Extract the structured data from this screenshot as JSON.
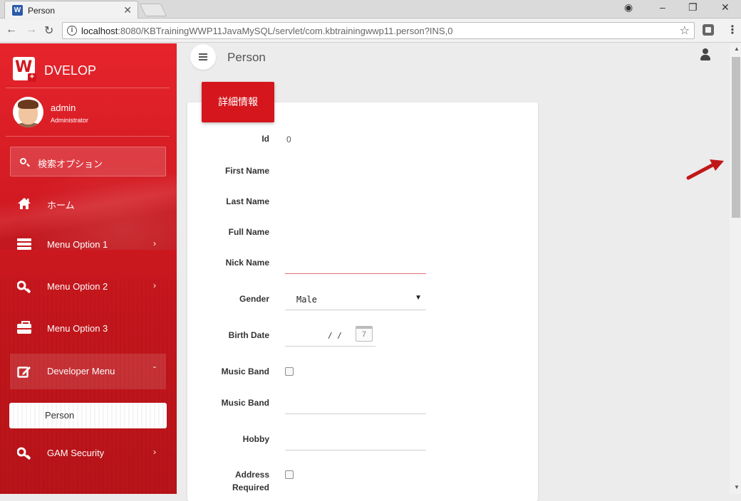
{
  "browser": {
    "tab_title": "Person",
    "tab_favicon_letter": "W",
    "url_host": "localhost",
    "url_rest": ":8080/KBTrainingWWP11JavaMySQL/servlet/com.kbtrainingwwp11.person?INS,0"
  },
  "brand": {
    "name": "DVELOP",
    "logo_letter": "W",
    "logo_badge": "+"
  },
  "user": {
    "name": "admin",
    "role": "Administrator"
  },
  "sidebar": {
    "search_label": "検索オプション",
    "items": [
      {
        "label": "ホーム",
        "icon": "home-icon",
        "has_submenu": false
      },
      {
        "label": "Menu Option 1",
        "icon": "list-icon",
        "has_submenu": true
      },
      {
        "label": "Menu Option 2",
        "icon": "key-icon",
        "has_submenu": true
      },
      {
        "label": "Menu Option 3",
        "icon": "briefcase-icon",
        "has_submenu": false
      },
      {
        "label": "Developer Menu",
        "icon": "edit-icon",
        "has_submenu": true,
        "expanded": true
      },
      {
        "label": "GAM Security",
        "icon": "key-icon",
        "has_submenu": true
      }
    ],
    "subitem": "Person",
    "chevron_right": "›",
    "chevron_down": "ˇ"
  },
  "header": {
    "title": "Person"
  },
  "card": {
    "tab_label": "詳細情報",
    "fields": {
      "id_label": "Id",
      "id_value": "0",
      "first_name_label": "First Name",
      "last_name_label": "Last Name",
      "full_name_label": "Full Name",
      "nick_name_label": "Nick Name",
      "gender_label": "Gender",
      "gender_value": "Male",
      "birth_date_label": "Birth Date",
      "birth_date_value": "/ /",
      "calendar_day": "7",
      "music_band_check_label": "Music Band",
      "music_band_label": "Music Band",
      "hobby_label": "Hobby",
      "address_required_label_1": "Address",
      "address_required_label_2": "Required"
    }
  },
  "colors": {
    "accent": "#d5161d",
    "sidebar_red": "#d21a22",
    "error_line": "#e07070"
  }
}
